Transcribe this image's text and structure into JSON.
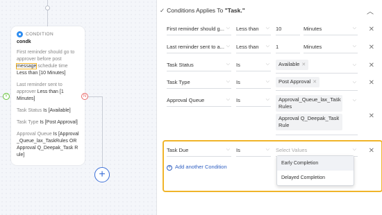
{
  "canvas": {
    "node": {
      "type": "CONDITION",
      "name": "condk",
      "rule1_a": "First reminder should go to approver before post ",
      "rule1_hl": "message",
      "rule1_b": " schedule time ",
      "rule1_op": "Less than",
      "rule1_val": " [10 Minutes]",
      "rule2_a": "Last reminder sent to approver ",
      "rule2_op": "Less than",
      "rule2_val": " [1 Minutes]",
      "rule3_a": "Task Status ",
      "rule3_op": "Is",
      "rule3_val": " [Available]",
      "rule4_a": "Task Type ",
      "rule4_op": "Is",
      "rule4_val": " [Post Approval]",
      "rule5_a": "Approval Queue ",
      "rule5_op": "Is",
      "rule5_val": " [Approval_Queue_lax_TaskRules OR Approval Q_Deepak_Task Rule]"
    },
    "yes_label": "Y",
    "no_label": "N",
    "add_label": "+"
  },
  "panel": {
    "header_prefix": "Conditions Applies To ",
    "header_target": "\"Task.\"",
    "rows": [
      {
        "field": "First reminder should g...",
        "operator": "Less than",
        "value": "10",
        "unit": "Minutes"
      },
      {
        "field": "Last reminder sent to a...",
        "operator": "Less than",
        "value": "1",
        "unit": "Minutes"
      },
      {
        "field": "Task Status",
        "operator": "Is",
        "chip": "Available"
      },
      {
        "field": "Task Type",
        "operator": "Is",
        "chip": "Post Approval"
      },
      {
        "field": "Approval Queue",
        "operator": "Is",
        "chip1": "Approval_Queue_lax_Task Rules",
        "chip2": "Approval Q_Deepak_Task Rule"
      },
      {
        "field": "Task Due",
        "operator": "Is",
        "placeholder": "Select Values"
      }
    ],
    "add_condition": "Add another Condition",
    "dropdown_options": [
      "Early Completion",
      "Delayed Completion"
    ]
  }
}
